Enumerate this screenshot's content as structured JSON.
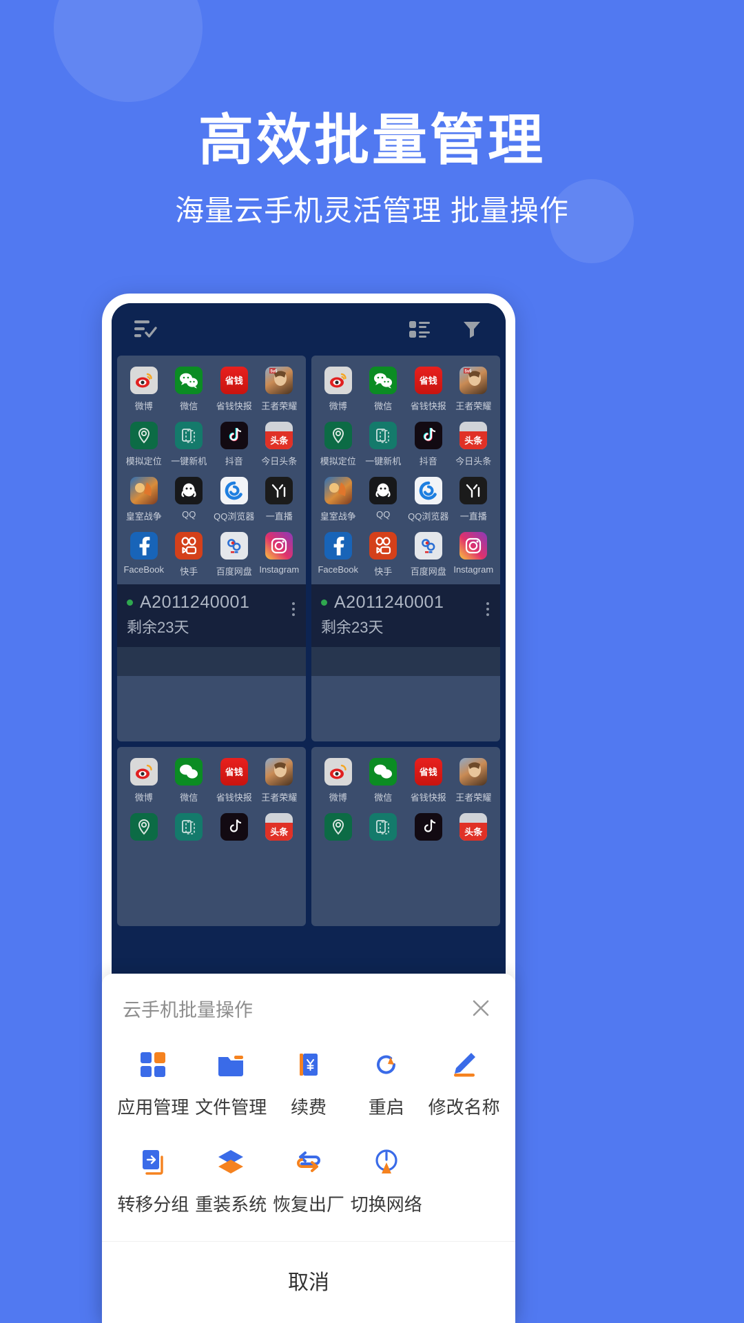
{
  "hero": {
    "title": "高效批量管理",
    "subtitle": "海量云手机灵活管理 批量操作"
  },
  "colors": {
    "background": "#5179F1",
    "accent_blue": "#3A6BE8",
    "accent_orange": "#F5821F",
    "screen_dark": "#0D2452",
    "card_bg": "#3B4D6D",
    "card_foot": "#16213C",
    "status_green": "#2FA84F"
  },
  "phone": {
    "appbar": {
      "select_all_icon": "list-check-icon",
      "view_toggle_icon": "grid-list-icon",
      "filter_icon": "funnel-filter-icon"
    },
    "apps": [
      {
        "label": "微博",
        "icon": "weibo-icon"
      },
      {
        "label": "微信",
        "icon": "wechat-icon"
      },
      {
        "label": "省钱快报",
        "icon": "shengqian-icon"
      },
      {
        "label": "王者荣耀",
        "icon": "honor-of-kings-icon"
      },
      {
        "label": "模拟定位",
        "icon": "location-pin-icon"
      },
      {
        "label": "一键新机",
        "icon": "new-device-icon"
      },
      {
        "label": "抖音",
        "icon": "douyin-icon"
      },
      {
        "label": "今日头条",
        "icon": "toutiao-icon"
      },
      {
        "label": "皇室战争",
        "icon": "clash-royale-icon"
      },
      {
        "label": "QQ",
        "icon": "qq-icon"
      },
      {
        "label": "QQ浏览器",
        "icon": "qq-browser-icon"
      },
      {
        "label": "一直播",
        "icon": "yizhibo-icon"
      },
      {
        "label": "FaceBook",
        "icon": "facebook-icon"
      },
      {
        "label": "快手",
        "icon": "kuaishou-icon"
      },
      {
        "label": "百度网盘",
        "icon": "baidu-pan-icon"
      },
      {
        "label": "Instagram",
        "icon": "instagram-icon"
      }
    ],
    "devices": [
      {
        "id": "A2011240001",
        "remaining": "剩余23天",
        "status": "online"
      },
      {
        "id": "A2011240001",
        "remaining": "剩余23天",
        "status": "online"
      }
    ]
  },
  "sheet": {
    "title": "云手机批量操作",
    "close_icon": "close-icon",
    "actions": [
      {
        "label": "应用管理",
        "icon": "app-grid-icon"
      },
      {
        "label": "文件管理",
        "icon": "folder-icon"
      },
      {
        "label": "续费",
        "icon": "renew-yuan-icon"
      },
      {
        "label": "重启",
        "icon": "restart-icon"
      },
      {
        "label": "修改名称",
        "icon": "pencil-edit-icon"
      },
      {
        "label": "转移分组",
        "icon": "move-group-icon"
      },
      {
        "label": "重装系统",
        "icon": "layers-reinstall-icon"
      },
      {
        "label": "恢复出厂",
        "icon": "factory-reset-icon"
      },
      {
        "label": "切换网络",
        "icon": "network-switch-icon"
      }
    ],
    "cancel_label": "取消"
  }
}
